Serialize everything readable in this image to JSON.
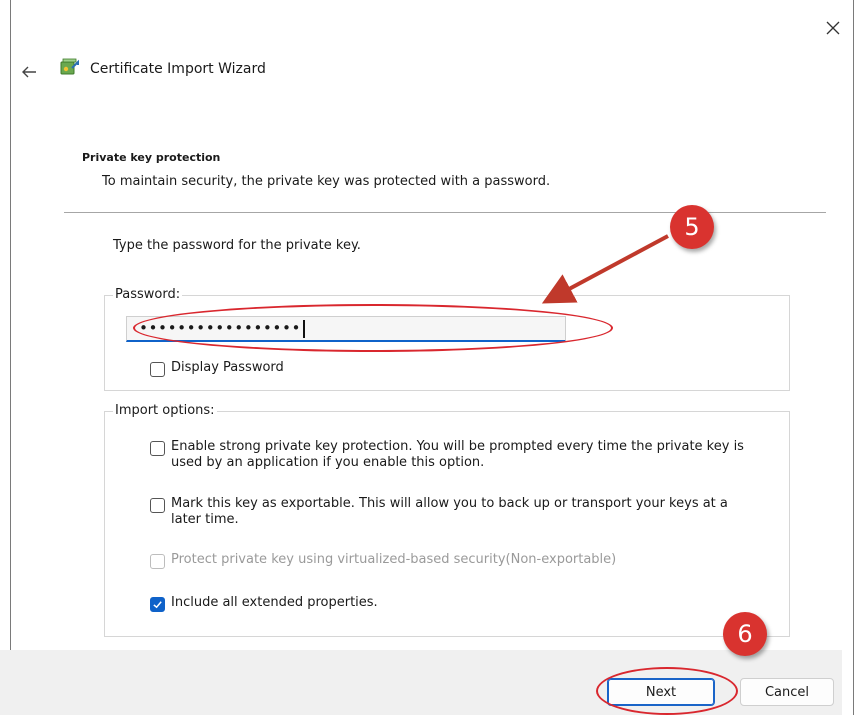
{
  "window": {
    "close_glyph": "×",
    "back_glyph": "←"
  },
  "wizard": {
    "title": "Certificate Import Wizard"
  },
  "section": {
    "title": "Private key protection",
    "description": "To maintain security, the private key was protected with a password."
  },
  "password_prompt": "Type the password for the private key.",
  "password_group": {
    "legend": "Password:",
    "value": "•••••••••••••••••",
    "display_password_label": "Display Password",
    "display_password_checked": false
  },
  "import_options": {
    "legend": "Import options:",
    "options": [
      {
        "label": "Enable strong private key protection. You will be prompted every time the private key is used by an application if you enable this option.",
        "checked": false,
        "disabled": false
      },
      {
        "label": "Mark this key as exportable. This will allow you to back up or transport your keys at a later time.",
        "checked": false,
        "disabled": false
      },
      {
        "label": "Protect private key using virtualized-based security(Non-exportable)",
        "checked": false,
        "disabled": true
      },
      {
        "label": "Include all extended properties.",
        "checked": true,
        "disabled": false
      }
    ]
  },
  "buttons": {
    "next": "Next",
    "cancel": "Cancel"
  },
  "annotations": {
    "step_password": "5",
    "step_next": "6",
    "color": "#d9272e"
  },
  "colors": {
    "accent": "#0f62c9",
    "annotation": "#d9332f",
    "footer_bg": "#f0f0f0"
  }
}
